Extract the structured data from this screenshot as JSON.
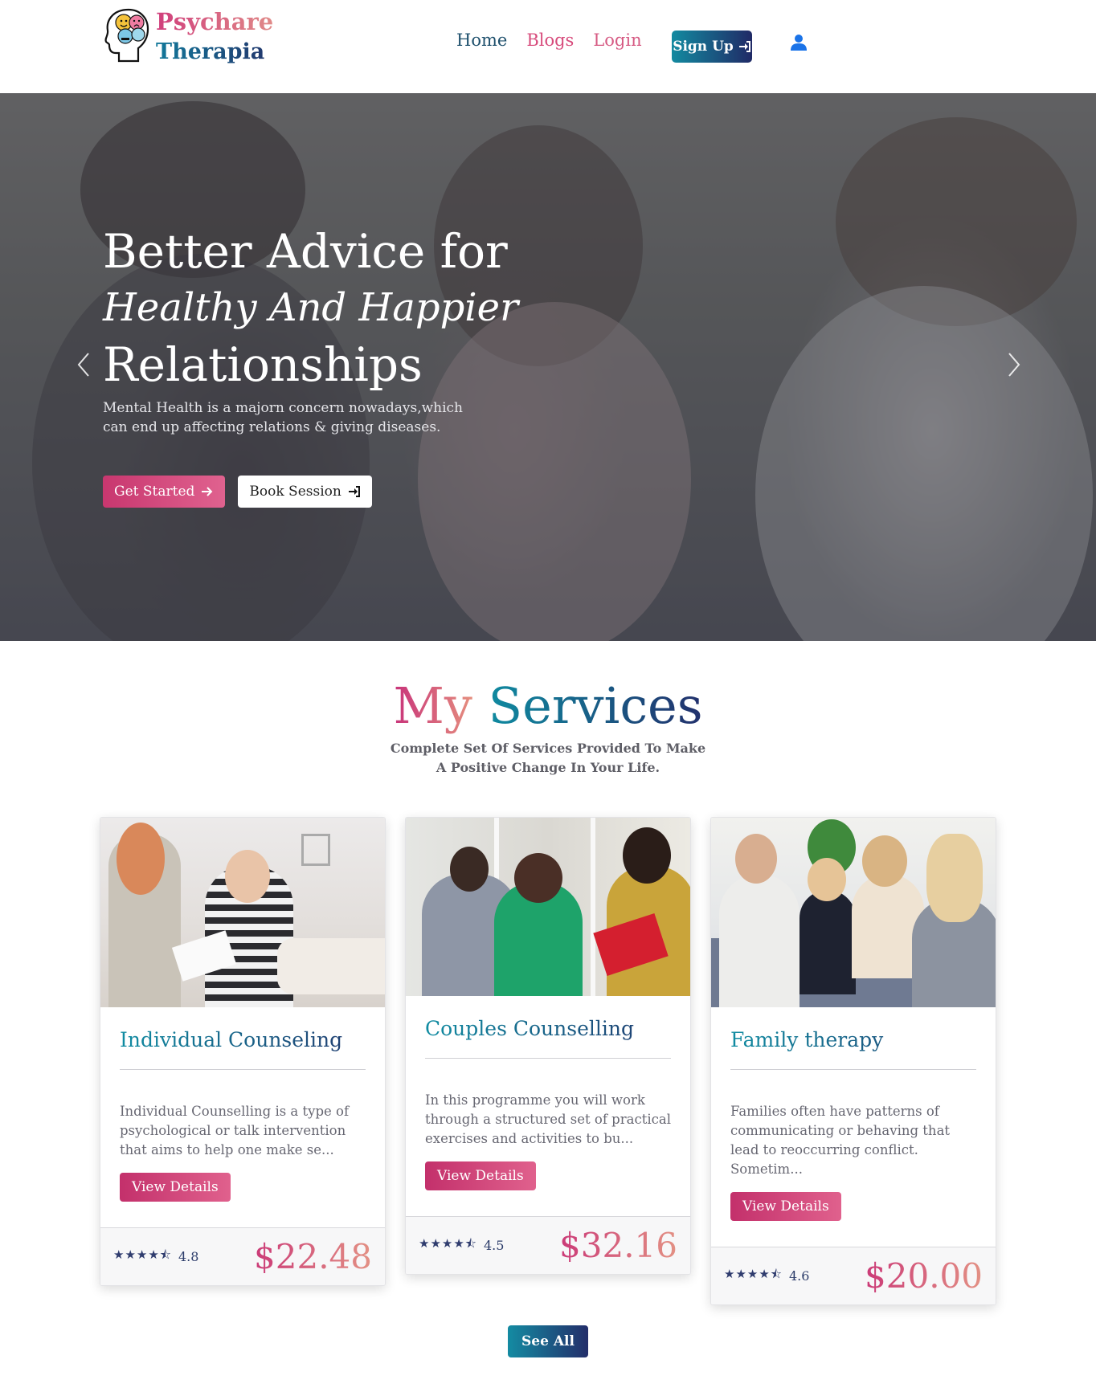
{
  "brand": {
    "line1": "Psychare",
    "line2": "Therapia",
    "logo_icon": "head-brain-emoji-icon"
  },
  "nav": {
    "home": "Home",
    "blogs": "Blogs",
    "login": "Login",
    "signup": "Sign Up",
    "signup_icon": "sign-in-icon",
    "user_icon": "user-icon"
  },
  "hero": {
    "line1": "Better Advice for",
    "line2": "Healthy And Happier",
    "line3": "Relationships",
    "subtitle": "Mental Health is a majorn concern nowadays,which can end up affecting relations & giving diseases.",
    "btn_start": "Get Started",
    "btn_start_icon": "arrow-right-icon",
    "btn_book": "Book Session",
    "btn_book_icon": "sign-in-icon",
    "prev_icon": "chevron-left-icon",
    "next_icon": "chevron-right-icon"
  },
  "services": {
    "title_my": "My",
    "title_services": "Services",
    "subtitle": "Complete Set Of Services Provided To Make A Positive Change In Your Life.",
    "cards": [
      {
        "title": "Individual Counseling",
        "description": "Individual Counselling is a type of psychological or talk intervention that aims to help one make se...",
        "button": "View Details",
        "rating": "4.8",
        "price": "$22.48"
      },
      {
        "title": "Couples Counselling",
        "description": "In this programme you will work through a structured set of practical exercises and activities to bu...",
        "button": "View Details",
        "rating": "4.5",
        "price": "$32.16"
      },
      {
        "title": "Family therapy",
        "description": "Families often have patterns of communicating or behaving that lead to reoccurring conflict. Sometim...",
        "button": "View Details",
        "rating": "4.6",
        "price": "$20.00"
      }
    ],
    "see_all": "See All"
  },
  "colors": {
    "pink_accent": "#d74a7b",
    "teal_accent": "#138aa0",
    "navy": "#202a66"
  }
}
